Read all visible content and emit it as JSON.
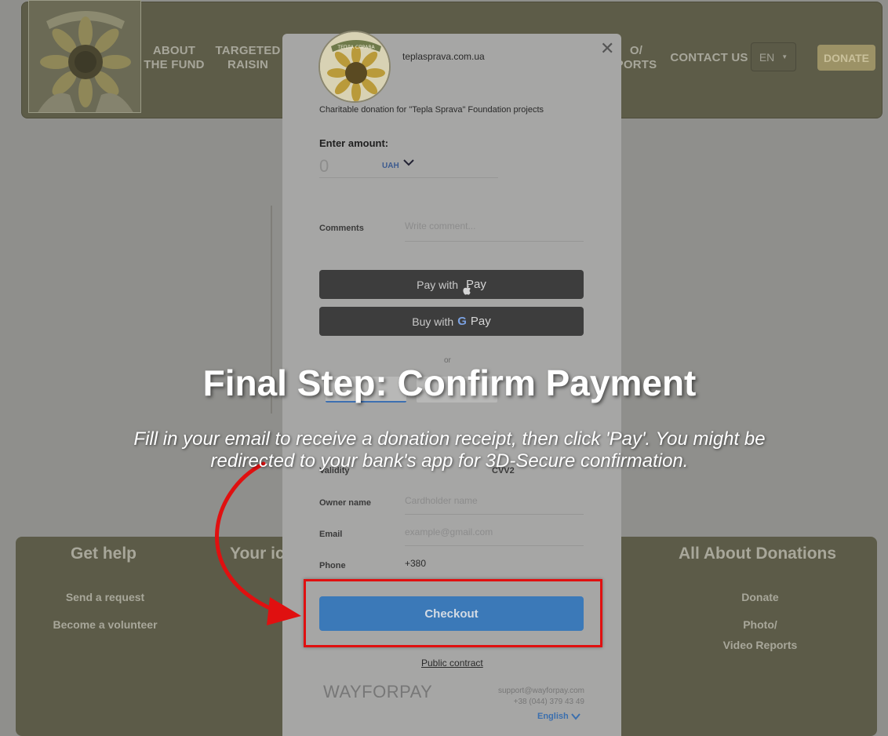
{
  "site": {
    "nav": [
      {
        "label": "ABOUT\nTHE FUND"
      },
      {
        "label": "TARGETED\nRAISIN"
      },
      {
        "label": "O/\nPORTS"
      },
      {
        "label": "CONTACT US"
      }
    ],
    "language": "EN",
    "donate_label": "DONATE"
  },
  "footer": {
    "get_help_title": "Get help",
    "get_help_links": [
      "Send a request",
      "Become a volunteer"
    ],
    "your_title": "Your ic",
    "donations_title": "All About Donations",
    "donations_links": [
      "Donate",
      "Photo/\nVideo Reports"
    ]
  },
  "modal": {
    "merchant": "teplasprava.com.ua",
    "logo_text": "ТЕПЛА СПРАВА",
    "purpose": "Charitable donation for \"Tepla Sprava\" Foundation projects",
    "amount_label": "Enter amount:",
    "amount_value": "0",
    "currency": "UAH",
    "comments_label": "Comments",
    "comments_placeholder": "Write comment...",
    "apple_pay": {
      "prefix": "Pay with",
      "suffix": "Pay"
    },
    "google_pay": {
      "prefix": "Buy with",
      "suffix": "Pay"
    },
    "or_label": "or",
    "validity_label": "Validity",
    "cvv_label": "CVV2",
    "owner_label": "Owner name",
    "owner_placeholder": "Cardholder name",
    "email_label": "Email",
    "email_placeholder": "example@gmail.com",
    "phone_label": "Phone",
    "phone_value": "+380",
    "checkout_label": "Checkout",
    "public_contract": "Public contract",
    "provider": "WAYFORPAY",
    "support_email": "support@wayforpay.com",
    "support_phone": "+38 (044) 379 43 49",
    "footer_language": "English"
  },
  "overlay": {
    "title": "Final Step: Confirm Payment",
    "body": "Fill in your email to receive a donation receipt, then click 'Pay'. You might be redirected to your bank's app for 3D-Secure confirmation."
  },
  "colors": {
    "highlight": "#e01010",
    "checkout": "#3b79b8",
    "dim_background": "#8f8f8c"
  }
}
